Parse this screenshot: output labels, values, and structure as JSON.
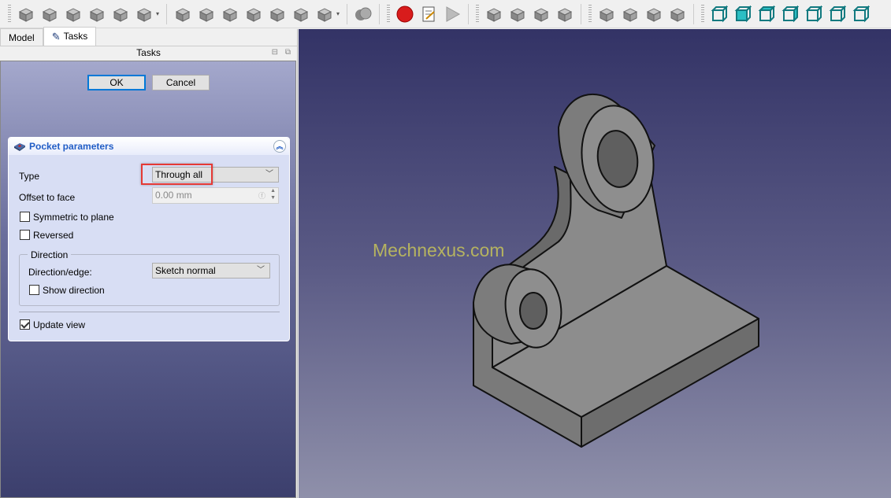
{
  "toolbar": {
    "groups": [
      {
        "icons": [
          "pad-icon",
          "revolution-icon",
          "additive-loft-icon",
          "additive-pipe-icon",
          "additive-helix-icon",
          "additive-primitive-icon"
        ]
      },
      {
        "icons": [
          "pocket-icon",
          "hole-icon",
          "groove-icon",
          "subtractive-loft-icon",
          "subtractive-pipe-icon",
          "subtractive-helix-icon",
          "subtractive-primitive-icon"
        ]
      },
      {
        "icons": [
          "boolean-icon"
        ]
      },
      {
        "icons": [
          "macro-record-icon",
          "macro-edit-icon",
          "macro-run-icon"
        ]
      },
      {
        "icons": [
          "fillet-icon",
          "chamfer-icon",
          "draft-icon",
          "thickness-icon"
        ]
      },
      {
        "icons": [
          "mirrored-icon",
          "linear-pattern-icon",
          "polar-pattern-icon",
          "multitransform-icon"
        ]
      },
      {
        "icons": [
          "view-isometric-icon",
          "view-front-icon",
          "view-top-icon",
          "view-right-icon",
          "view-rear-icon",
          "view-bottom-icon",
          "view-left-icon"
        ]
      }
    ]
  },
  "colors": {
    "accent": "#215dc6",
    "highlight": "#e53935",
    "record": "#d81c1c",
    "view_cube": "#2bbfc4",
    "model_face": "#8a8a8a"
  },
  "tabs": [
    {
      "label": "Model"
    },
    {
      "label": "Tasks"
    }
  ],
  "tasks_title": "Tasks",
  "buttons": {
    "ok": "OK",
    "cancel": "Cancel"
  },
  "pocket": {
    "title": "Pocket parameters",
    "type_label": "Type",
    "type_value": "Through all",
    "offset_label": "Offset to face",
    "offset_value": "0.00 mm",
    "symmetric_label": "Symmetric to plane",
    "symmetric_checked": false,
    "reversed_label": "Reversed",
    "reversed_checked": false,
    "direction_group": "Direction",
    "direction_edge_label": "Direction/edge:",
    "direction_edge_value": "Sketch normal",
    "show_direction_label": "Show direction",
    "show_direction_checked": false,
    "update_view_label": "Update view",
    "update_view_checked": true
  },
  "viewport": {
    "watermark": "Mechnexus.com"
  }
}
